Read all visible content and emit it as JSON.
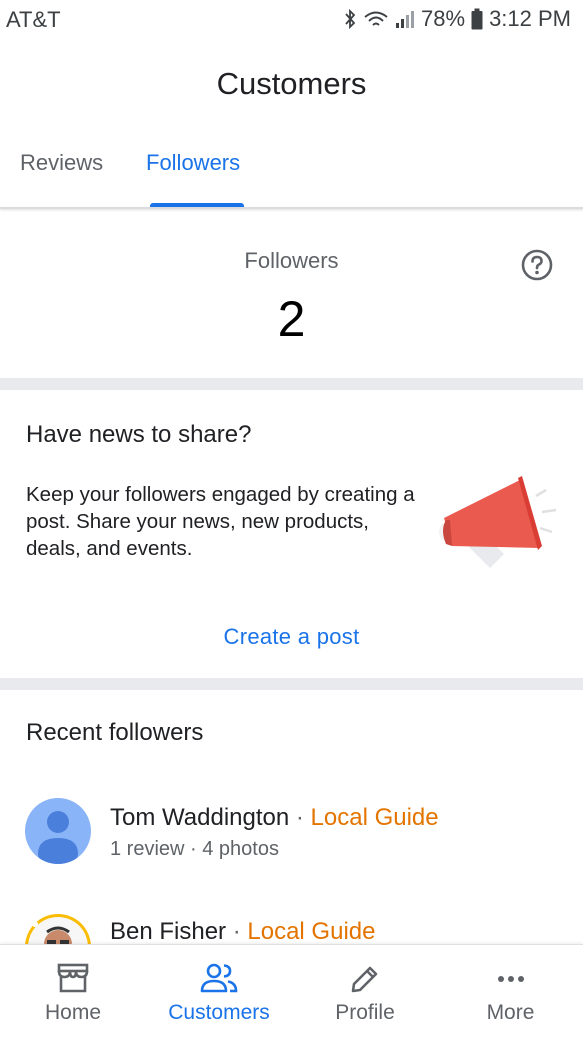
{
  "status_bar": {
    "carrier": "AT&T",
    "battery": "78%",
    "time": "3:12 PM"
  },
  "header": {
    "title": "Customers"
  },
  "tabs": [
    {
      "label": "Reviews",
      "active": false
    },
    {
      "label": "Followers",
      "active": true
    }
  ],
  "followers_summary": {
    "label": "Followers",
    "count": "2",
    "help_icon": "help-circle-icon"
  },
  "news_card": {
    "title": "Have news to share?",
    "body": "Keep your followers engaged by creating a post. Share your news, new products, deals, and events.",
    "illustration": "megaphone-icon",
    "action_label": "Create a post"
  },
  "recent_followers": {
    "title": "Recent followers",
    "items": [
      {
        "name": "Tom Waddington",
        "separator": " · ",
        "badge": "Local Guide",
        "meta": "1 review · 4 photos",
        "avatar": "default-person-avatar"
      },
      {
        "name": "Ben Fisher",
        "separator": " · ",
        "badge": "Local Guide",
        "meta": "",
        "avatar": "photo-avatar"
      }
    ]
  },
  "bottom_nav": [
    {
      "label": "Home",
      "icon": "storefront-icon",
      "active": false
    },
    {
      "label": "Customers",
      "icon": "people-icon",
      "active": true
    },
    {
      "label": "Profile",
      "icon": "pencil-icon",
      "active": false
    },
    {
      "label": "More",
      "icon": "more-horizontal-icon",
      "active": false
    }
  ],
  "colors": {
    "accent": "#1a73e8",
    "local_guide": "#e37400",
    "megaphone": "#ea5a4f",
    "avatar_bg": "#8ab4f8",
    "avatar_fg": "#4a7fdc"
  }
}
